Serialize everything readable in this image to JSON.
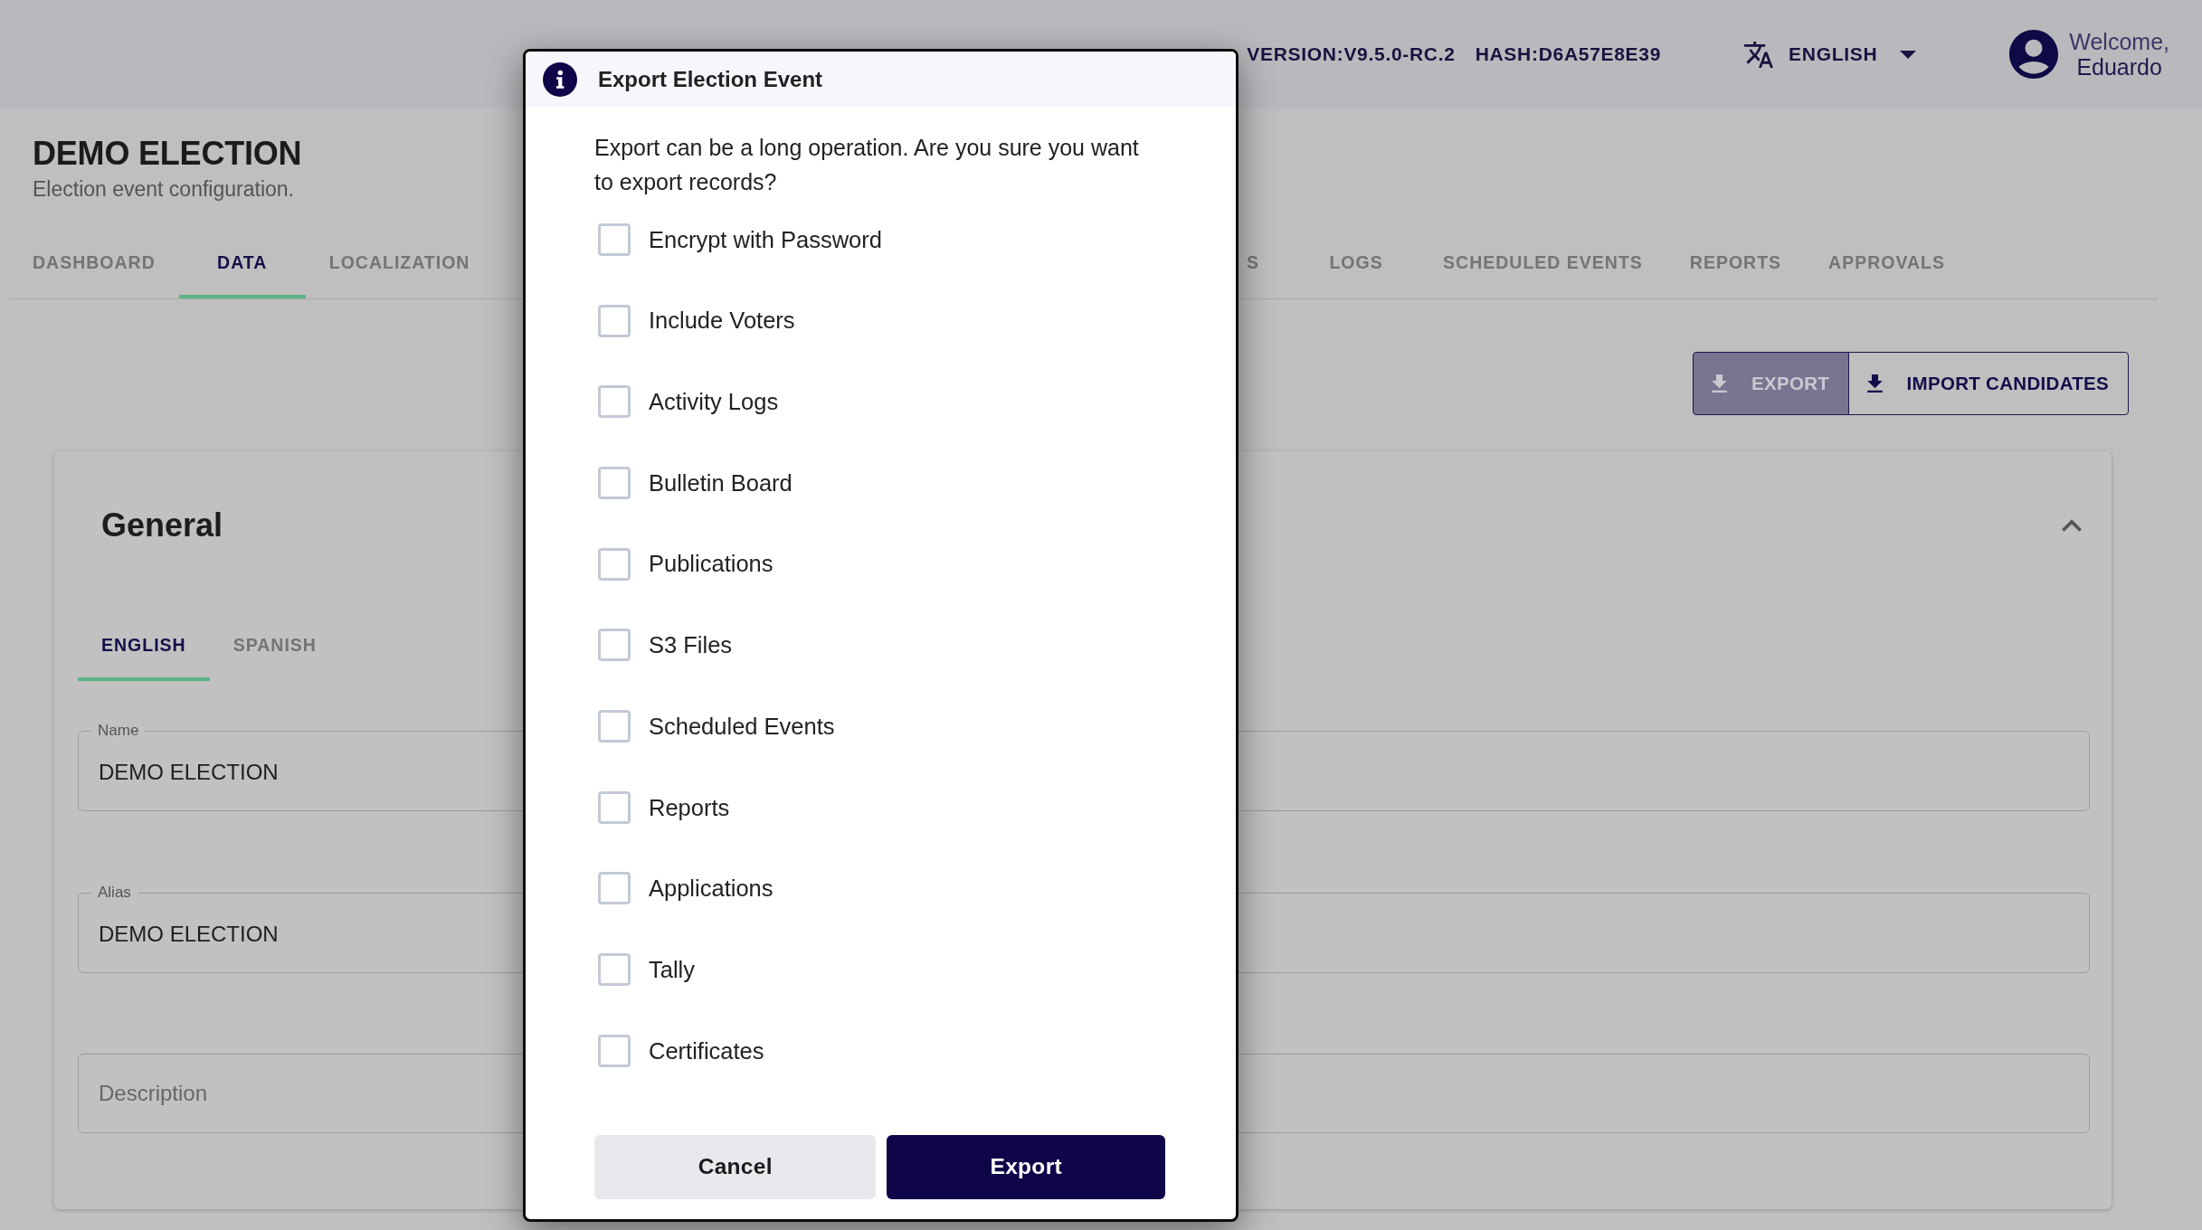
{
  "header": {
    "version": "VERSION:V9.5.0-RC.2",
    "hash": "HASH:D6A57E8E39",
    "language": "ENGLISH",
    "user": {
      "greeting": "Welcome,",
      "name": "Eduardo"
    }
  },
  "page": {
    "title": "DEMO ELECTION",
    "subtitle": "Election event configuration."
  },
  "tabs": [
    {
      "label": "DASHBOARD",
      "selected": false
    },
    {
      "label": "DATA",
      "selected": true
    },
    {
      "label": "LOCALIZATION",
      "selected": false
    },
    {
      "label": "S",
      "selected": false
    },
    {
      "label": "LOGS",
      "selected": false
    },
    {
      "label": "SCHEDULED EVENTS",
      "selected": false
    },
    {
      "label": "REPORTS",
      "selected": false
    },
    {
      "label": "APPROVALS",
      "selected": false
    }
  ],
  "toolbar": [
    {
      "label": "EXPORT",
      "kind": "contained"
    },
    {
      "label": "IMPORT CANDIDATES",
      "kind": "outlined"
    }
  ],
  "section": {
    "title": "General",
    "expanded": true,
    "language_tabs": [
      {
        "label": "ENGLISH",
        "selected": true
      },
      {
        "label": "SPANISH",
        "selected": false
      }
    ],
    "fields": [
      {
        "label": "Name",
        "value": "DEMO ELECTION"
      },
      {
        "label": "Alias",
        "value": "DEMO ELECTION"
      },
      {
        "placeholder": "Description"
      }
    ]
  },
  "dialog": {
    "title": "Export Election Event",
    "message": "Export can be a long operation. Are you sure you want to export records?",
    "options": [
      {
        "label": "Encrypt with Password",
        "checked": false
      },
      {
        "label": "Include Voters",
        "checked": false
      },
      {
        "label": "Activity Logs",
        "checked": false
      },
      {
        "label": "Bulletin Board",
        "checked": false
      },
      {
        "label": "Publications",
        "checked": false
      },
      {
        "label": "S3 Files",
        "checked": false
      },
      {
        "label": "Scheduled Events",
        "checked": false
      },
      {
        "label": "Reports",
        "checked": false
      },
      {
        "label": "Applications",
        "checked": false
      },
      {
        "label": "Tally",
        "checked": false
      },
      {
        "label": "Certificates",
        "checked": false
      }
    ],
    "buttons": [
      {
        "label": "Cancel",
        "kind": "cancel"
      },
      {
        "label": "Export",
        "kind": "confirm"
      }
    ]
  }
}
